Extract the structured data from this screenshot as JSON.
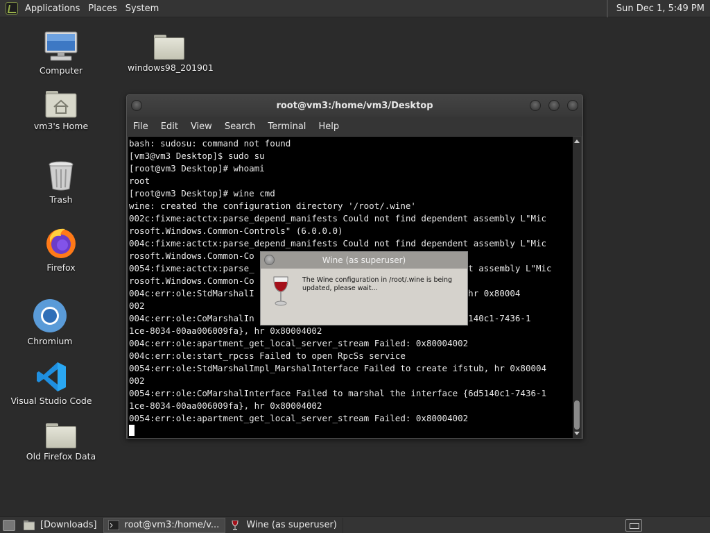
{
  "top_panel": {
    "menus": [
      "Applications",
      "Places",
      "System"
    ],
    "clock": "Sun Dec 1,  5:49 PM"
  },
  "desktop_icons": [
    {
      "label": "Computer",
      "icon": "computer-icon"
    },
    {
      "label": "windows98_201901",
      "icon": "folder-icon"
    },
    {
      "label": "vm3's Home",
      "icon": "home-folder-icon"
    },
    {
      "label": "Trash",
      "icon": "trash-icon"
    },
    {
      "label": "Firefox",
      "icon": "firefox-icon"
    },
    {
      "label": "Chromium",
      "icon": "chromium-icon"
    },
    {
      "label": "Visual Studio Code",
      "icon": "vscode-icon"
    },
    {
      "label": "Old Firefox Data",
      "icon": "folder-icon"
    }
  ],
  "terminal": {
    "title": "root@vm3:/home/vm3/Desktop",
    "menu": [
      "File",
      "Edit",
      "View",
      "Search",
      "Terminal",
      "Help"
    ],
    "lines": [
      "bash: sudosu: command not found",
      "[vm3@vm3 Desktop]$ sudo su",
      "[root@vm3 Desktop]# whoami",
      "root",
      "[root@vm3 Desktop]# wine cmd",
      "wine: created the configuration directory '/root/.wine'",
      "002c:fixme:actctx:parse_depend_manifests Could not find dependent assembly L\"Mic",
      "rosoft.Windows.Common-Controls\" (6.0.0.0)",
      "004c:fixme:actctx:parse_depend_manifests Could not find dependent assembly L\"Mic",
      "rosoft.Windows.Common-Co",
      "0054:fixme:actctx:parse_                                 dependent assembly L\"Mic",
      "rosoft.Windows.Common-Co",
      "004c:err:ole:StdMarshalI                                 ifstub, hr 0x80004",
      "002",
      "004c:err:ole:CoMarshalIn                                 ace {6d5140c1-7436-1",
      "1ce-8034-00aa006009fa}, hr 0x80004002",
      "004c:err:ole:apartment_get_local_server_stream Failed: 0x80004002",
      "004c:err:ole:start_rpcss Failed to open RpcSs service",
      "0054:err:ole:StdMarshalImpl_MarshalInterface Failed to create ifstub, hr 0x80004",
      "002",
      "0054:err:ole:CoMarshalInterface Failed to marshal the interface {6d5140c1-7436-1",
      "1ce-8034-00aa006009fa}, hr 0x80004002",
      "0054:err:ole:apartment_get_local_server_stream Failed: 0x80004002"
    ]
  },
  "wine_dialog": {
    "title": "Wine (as superuser)",
    "message": "The Wine configuration in /root/.wine is being updated, please wait..."
  },
  "taskbar": {
    "tasks": [
      {
        "label": "[Downloads]",
        "icon": "folder-icon"
      },
      {
        "label": "root@vm3:/home/v...",
        "icon": "terminal-icon"
      },
      {
        "label": "Wine (as superuser)",
        "icon": "wine-glass-icon"
      }
    ]
  }
}
